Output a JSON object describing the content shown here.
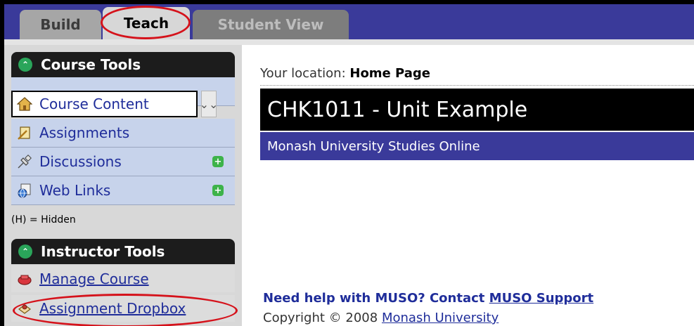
{
  "tabs": [
    {
      "label": "Build"
    },
    {
      "label": "Teach"
    },
    {
      "label": "Student View"
    }
  ],
  "course_tools": {
    "title": "Course Tools",
    "items": [
      {
        "label": "Course Content",
        "icon": "home-icon"
      },
      {
        "label": "Assignments",
        "icon": "assignment-icon"
      },
      {
        "label": "Discussions",
        "icon": "pushpin-icon",
        "badge": "+"
      },
      {
        "label": "Web Links",
        "icon": "globe-icon",
        "badge": "+"
      }
    ],
    "hidden_note": "(H) = Hidden"
  },
  "instructor_tools": {
    "title": "Instructor Tools",
    "items": [
      {
        "label": "Manage Course",
        "icon": "toolbox-icon"
      },
      {
        "label": "Assignment Dropbox",
        "icon": "dropbox-icon"
      }
    ]
  },
  "main": {
    "location_label": "Your location:",
    "location_value": "Home Page",
    "unit_title": "CHK1011 - Unit Example",
    "unit_subtitle": "Monash University Studies Online",
    "help_text": "Need help with MUSO? Contact",
    "help_link": "MUSO Support",
    "copyright_text": "Copyright © 2008",
    "copyright_link": "Monash University"
  },
  "colors": {
    "tab_bar": "#3a3a9a",
    "highlight_ring": "#d5121b",
    "link": "#1f2d9a"
  }
}
